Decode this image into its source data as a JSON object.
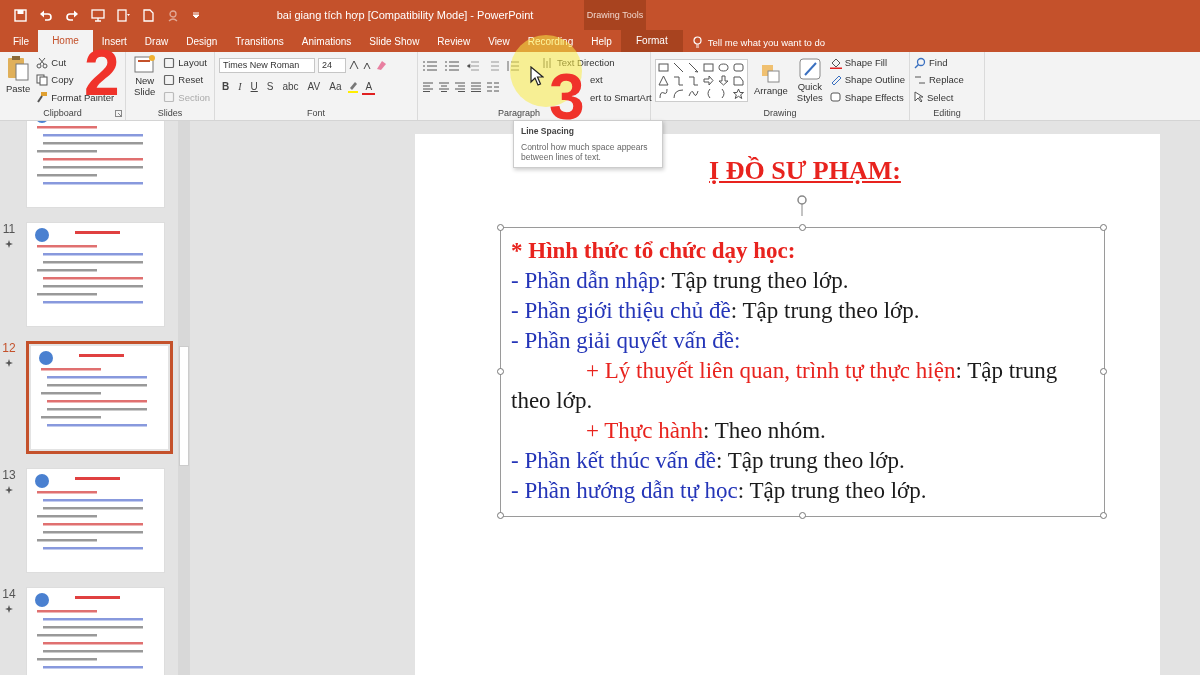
{
  "title_bar": {
    "title": "bai giang tích hợp [Compatibility Mode]  -  PowerPoint",
    "contextual_header": "Drawing Tools"
  },
  "tabs": [
    {
      "label": "File",
      "selected": false
    },
    {
      "label": "Home",
      "selected": true
    },
    {
      "label": "Insert",
      "selected": false
    },
    {
      "label": "Draw",
      "selected": false
    },
    {
      "label": "Design",
      "selected": false
    },
    {
      "label": "Transitions",
      "selected": false
    },
    {
      "label": "Animations",
      "selected": false
    },
    {
      "label": "Slide Show",
      "selected": false
    },
    {
      "label": "Review",
      "selected": false
    },
    {
      "label": "View",
      "selected": false
    },
    {
      "label": "Recording",
      "selected": false
    },
    {
      "label": "Help",
      "selected": false
    },
    {
      "label": "Format",
      "selected": false,
      "kind": "contextual"
    }
  ],
  "tell_me": "Tell me what you want to do",
  "ribbon": {
    "clipboard": {
      "label": "Clipboard",
      "paste": "Paste",
      "cut": "Cut",
      "copy": "Copy",
      "format_painter": "Format Painter"
    },
    "slides": {
      "label": "Slides",
      "new_slide": "New Slide",
      "layout": "Layout",
      "reset": "Reset",
      "section": {
        "label": "Section",
        "disabled": true
      }
    },
    "font": {
      "label": "Font",
      "font_name": "Times New Roman",
      "font_size": "24",
      "style_buttons": [
        "B",
        "I",
        "U",
        "S",
        "abc",
        "AV",
        "Aa"
      ],
      "font_color": "A"
    },
    "paragraph": {
      "label": "Paragraph",
      "text_direction": "Text Direction",
      "align_text": "ext",
      "convert": "ert to SmartArt"
    },
    "drawing": {
      "label": "Drawing",
      "arrange": "Arrange",
      "quick_styles": "Quick Styles",
      "shape_fill": "Shape Fill",
      "shape_outline": "Shape Outline",
      "shape_effects": "Shape Effects"
    },
    "editing": {
      "label": "Editing",
      "find": "Find",
      "replace": "Replace",
      "select": "Select"
    }
  },
  "thumbnails": [
    {
      "selected": false
    },
    {
      "number": "11",
      "selected": false,
      "animated": true
    },
    {
      "number": "12",
      "selected": true,
      "animated": true
    },
    {
      "number": "13",
      "selected": false,
      "animated": true
    },
    {
      "number": "14",
      "selected": false,
      "animated": true
    }
  ],
  "slide": {
    "title": "Ị ĐỒ SƯ PHẠM:",
    "heading": "* Hình thức tổ chức dạy học:",
    "lines": [
      {
        "kind": "item",
        "term": "- Phần dẫn nhập",
        "rest": ": Tập trung theo lớp."
      },
      {
        "kind": "item",
        "term": "- Phần giới thiệu chủ đề",
        "rest": ": Tập trung theo lớp."
      },
      {
        "kind": "item",
        "term": "- Phần giải quyết vấn đề:"
      },
      {
        "kind": "sub",
        "term": "+ Lý thuyết liên quan, trình tự thực hiện",
        "rest": ": Tập trung theo lớp."
      },
      {
        "kind": "sub",
        "term": "+ Thực hành",
        "rest": ": Theo nhóm."
      },
      {
        "kind": "item",
        "term": "- Phần kết thúc vấn đề",
        "rest": ": Tập trung theo lớp."
      },
      {
        "kind": "item",
        "term": "- Phần hướng dẫn tự học",
        "rest": ": Tập trung theo lớp."
      }
    ]
  },
  "tooltip": {
    "title": "Line Spacing",
    "text": "Control how much space appears between lines of text."
  },
  "annotations": [
    "2",
    "3"
  ]
}
